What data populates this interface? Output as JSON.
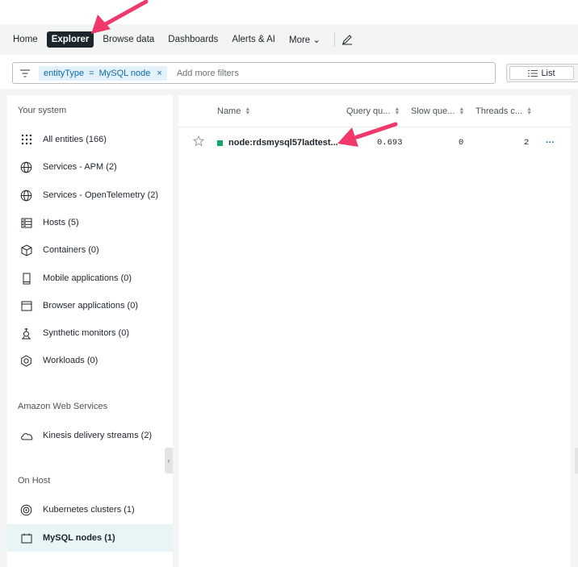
{
  "nav": {
    "items": [
      {
        "label": "Home",
        "active": false
      },
      {
        "label": "Explorer",
        "active": true
      },
      {
        "label": "Browse data",
        "active": false
      },
      {
        "label": "Dashboards",
        "active": false
      },
      {
        "label": "Alerts & AI",
        "active": false
      },
      {
        "label": "More ⌄",
        "active": false
      }
    ],
    "edit_icon": "pencil-icon"
  },
  "filter": {
    "chip_key": "entityType",
    "chip_op": "=",
    "chip_value": "MySQL node",
    "chip_remove": "×",
    "placeholder": "Add more filters"
  },
  "view": {
    "list_label": "List"
  },
  "sidebar": {
    "sections": [
      {
        "title": "Your system"
      },
      {
        "title": "Amazon Web Services"
      },
      {
        "title": "On Host"
      }
    ],
    "items": [
      {
        "label": "All entities (166)",
        "icon": "grid-dots-icon"
      },
      {
        "label": "Services - APM (2)",
        "icon": "globe-icon"
      },
      {
        "label": "Services - OpenTelemetry (2)",
        "icon": "globe-icon"
      },
      {
        "label": "Hosts (5)",
        "icon": "server-icon"
      },
      {
        "label": "Containers (0)",
        "icon": "cube-icon"
      },
      {
        "label": "Mobile applications (0)",
        "icon": "mobile-icon"
      },
      {
        "label": "Browser applications (0)",
        "icon": "browser-window-icon"
      },
      {
        "label": "Synthetic monitors (0)",
        "icon": "synthetic-icon"
      },
      {
        "label": "Workloads (0)",
        "icon": "workload-icon"
      },
      {
        "label": "Kinesis delivery streams (2)",
        "icon": "cloud-icon"
      },
      {
        "label": "Kubernetes clusters (1)",
        "icon": "kubernetes-icon"
      },
      {
        "label": "MySQL nodes (1)",
        "icon": "calendar-box-icon",
        "selected": true
      }
    ]
  },
  "table": {
    "columns": [
      "Name",
      "Query qu...",
      "Slow que...",
      "Threads c..."
    ],
    "rows": [
      {
        "name": "node:rdsmysql57ladtest...",
        "health": "#11a968",
        "query": "0.693",
        "slow": "0",
        "threads": "2",
        "menu": "···"
      }
    ]
  },
  "colors": {
    "accent": "#0d6aa8",
    "annotation_arrow": "#f0386b",
    "nav_active": "#1d252c",
    "healthy": "#11a968"
  }
}
